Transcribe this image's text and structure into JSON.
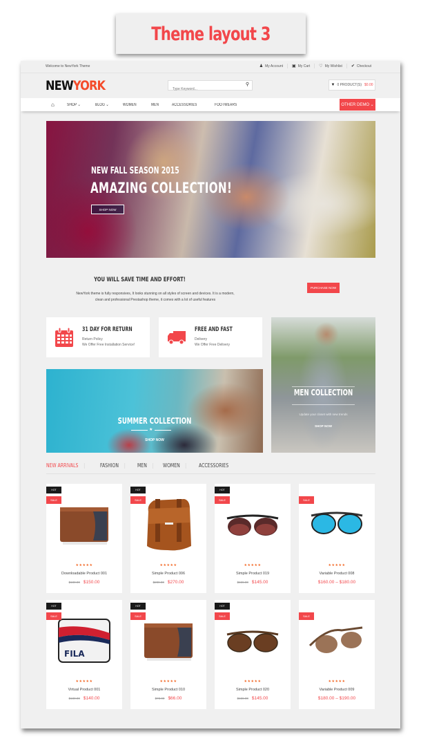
{
  "caption": "Theme layout 3",
  "topbar": {
    "welcome": "Welcome to NewYork Theme",
    "links": [
      {
        "icon": "user-icon",
        "label": "My Account"
      },
      {
        "icon": "bag-icon",
        "label": "My Cart"
      },
      {
        "icon": "heart-icon",
        "label": "My Wishlist"
      },
      {
        "icon": "check-circle-icon",
        "label": "Checkout"
      }
    ]
  },
  "header": {
    "logo_part1": "NEW",
    "logo_part2": "YORK",
    "search_placeholder": "Type Keyword...",
    "cart_label": "0 PRODUCT(S)",
    "cart_total": "$0.00"
  },
  "nav": {
    "items": [
      "Shop",
      "Blog",
      "Women",
      "Men",
      "Accessories",
      "Footwears"
    ],
    "dropdown_items": [
      "Shop",
      "Blog"
    ],
    "other_demo": "Other Demo"
  },
  "hero": {
    "subtitle": "NEW FALL SEASON 2015",
    "title": "AMAZING COLLECTION!",
    "button": "SHOP NOW"
  },
  "intro": {
    "title": "YOU WILL SAVE TIME AND EFFORT!",
    "text": "NewYork theme is fully responsives, It looks stunning on all styles of screen and devices. It is a modern, clean and professional Prestashop theme, it comes with a lot of useful features",
    "button": "PURCHASE NOW"
  },
  "features": [
    {
      "icon": "calendar-icon",
      "title": "31 DAY FOR RETURN",
      "line1": "Return Policy",
      "line2": "We Offer Free Installation Service!"
    },
    {
      "icon": "truck-icon",
      "title": "FREE AND FAST",
      "line1": "Delivery",
      "line2": "We Offer Free Delivery"
    }
  ],
  "banners": {
    "summer": {
      "title": "SUMMER COLLECTION",
      "button": "SHOP NOW"
    },
    "men": {
      "title": "MEN COLLECTION",
      "desc": "Update your closet with new trends",
      "button": "SHOP NOW"
    }
  },
  "tabs": [
    {
      "label": "NEW ARRIVALS",
      "active": true
    },
    {
      "label": "FASHION",
      "active": false
    },
    {
      "label": "MEN",
      "active": false
    },
    {
      "label": "WOMEN",
      "active": false
    },
    {
      "label": "ACCESSORIES",
      "active": false
    }
  ],
  "badges": {
    "hot": "HOT",
    "sale": "SALE"
  },
  "rating_stars": "★★★★★",
  "products": [
    {
      "name": "Downloadable Product 001",
      "old_price": "$180.00",
      "price": "$150.00",
      "hot": true,
      "sale": true,
      "image": "wallet"
    },
    {
      "name": "Simple Product 006",
      "old_price": "$289.00",
      "price": "$270.00",
      "hot": true,
      "sale": true,
      "image": "bag"
    },
    {
      "name": "Simple Product 019",
      "old_price": "$155.00",
      "price": "$145.00",
      "hot": true,
      "sale": true,
      "image": "sunglasses-dark"
    },
    {
      "name": "Variable Product 008",
      "old_price": "",
      "price": "$160.00 – $180.00",
      "hot": false,
      "sale": true,
      "image": "sunglasses-blue"
    },
    {
      "name": "Virtual Product 001",
      "old_price": "$180.00",
      "price": "$140.00",
      "hot": true,
      "sale": true,
      "image": "fila-bag"
    },
    {
      "name": "Simple Product 010",
      "old_price": "$73.00",
      "price": "$66.00",
      "hot": true,
      "sale": true,
      "image": "wallet"
    },
    {
      "name": "Simple Product 020",
      "old_price": "$155.00",
      "price": "$145.00",
      "hot": true,
      "sale": true,
      "image": "sunglasses-brown"
    },
    {
      "name": "Variable Product 009",
      "old_price": "",
      "price": "$180.00 – $190.00",
      "hot": false,
      "sale": true,
      "image": "sunglasses-brown2"
    }
  ],
  "colors": {
    "accent": "#f2474b",
    "logo_accent": "#f44b2a",
    "stars": "#f26522"
  }
}
